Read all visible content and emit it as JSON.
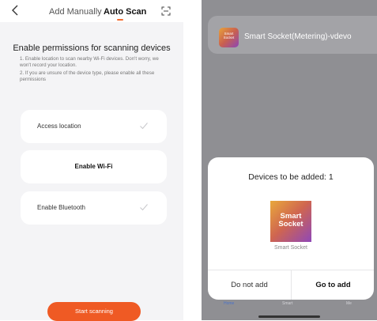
{
  "left_screen": {
    "header": {
      "back_icon": "chevron-left-icon",
      "tab_manual": "Add Manually",
      "tab_auto": "Auto Scan",
      "active_tab": "Auto Scan",
      "scan_icon": "scan-frame-icon"
    },
    "title": "Enable permissions for scanning devices",
    "notes": [
      "1. Enable location to scan nearby Wi-Fi devices. Don't worry, we won't record your location.",
      "2. If you are unsure of the device type, please enable all these permissions"
    ],
    "permissions": [
      {
        "label": "Access location",
        "checked": true
      },
      {
        "label": "Enable Wi-Fi",
        "checked": false
      },
      {
        "label": "Enable Bluetooth",
        "checked": true
      }
    ],
    "start_button": "Start scanning",
    "colors": {
      "accent": "#ef5a24",
      "background": "#f4f4f6"
    }
  },
  "right_screen": {
    "device_banner": {
      "icon_text": "Smart\nSocket",
      "name": "Smart Socket(Metering)-vdevo"
    },
    "modal": {
      "title": "Devices to be added: 1",
      "device_icon_text": "Smart\nSocket",
      "device_name": "Smart Socket",
      "cancel_button": "Do not add",
      "confirm_button": "Go to add"
    },
    "tabbar": {
      "home": "Home",
      "smart": "Smart",
      "me": "Me"
    },
    "colors": {
      "overlay": "#8f8f93"
    }
  }
}
